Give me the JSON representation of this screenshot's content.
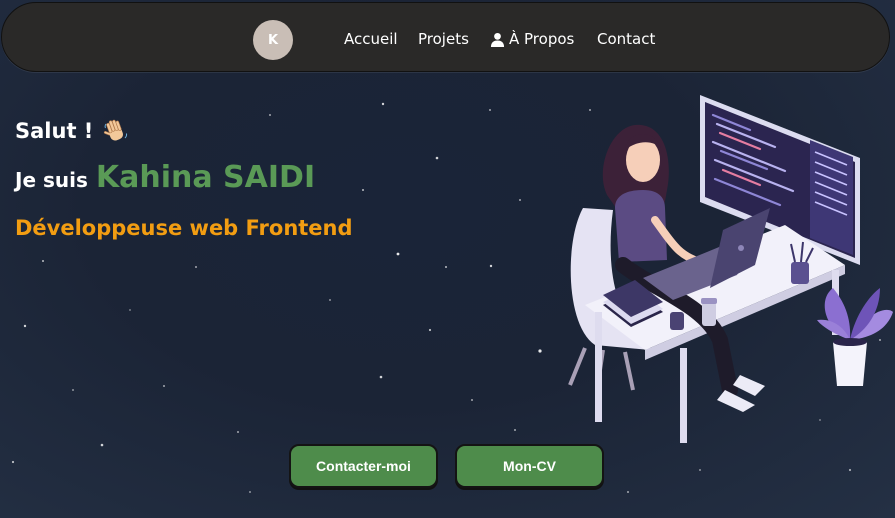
{
  "nav": {
    "logo_letter": "K",
    "items": [
      {
        "label": "Accueil"
      },
      {
        "label": "Projets"
      },
      {
        "label": "À Propos",
        "icon": "user-icon"
      },
      {
        "label": "Contact"
      }
    ]
  },
  "hero": {
    "greeting": "Salut !",
    "greeting_icon": "waving-hand-icon",
    "intro_prefix": "Je suis",
    "name": "Kahina SAIDI",
    "role": "Développeuse web Frontend"
  },
  "buttons": {
    "contact_label": "Contacter-moi",
    "cv_label": "Mon-CV"
  },
  "colors": {
    "background": "#1b2436",
    "navbar": "#2a2928",
    "name": "#5a9a56",
    "role": "#f29d12",
    "button": "#4e8c4b",
    "logo": "#c9beb6"
  }
}
